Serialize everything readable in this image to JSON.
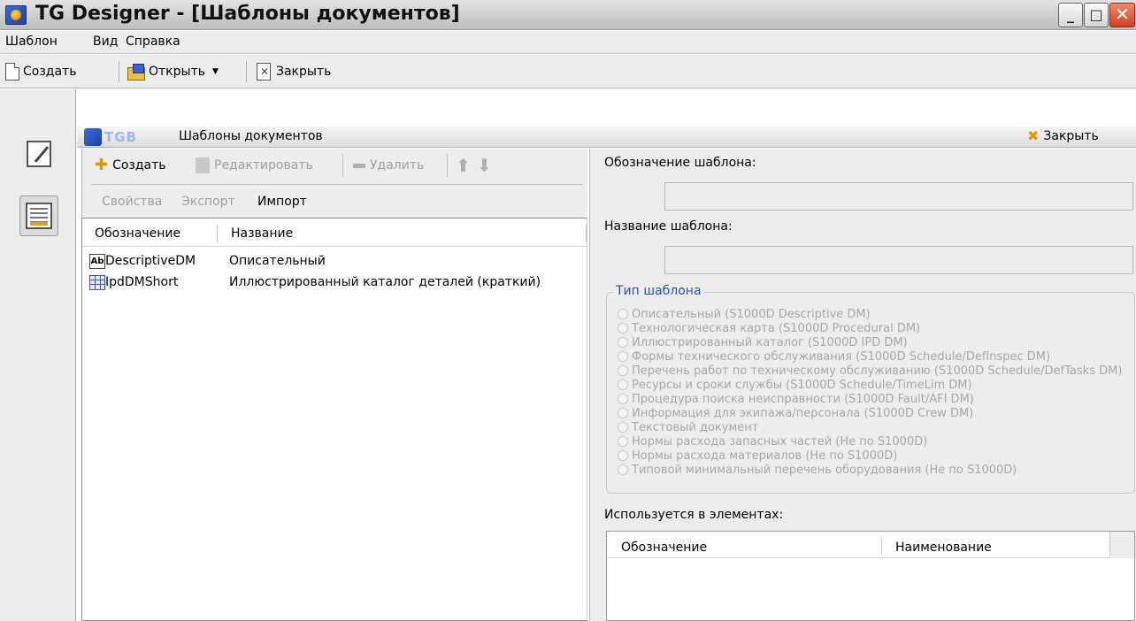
{
  "window": {
    "title": "TG Designer - [Шаблоны документов]",
    "minimize": "_",
    "maximize": "□",
    "close": "✕"
  },
  "menu": [
    "Шаблон",
    "Вид",
    "Справка"
  ],
  "toolbar": {
    "create": "Создать",
    "open": "Открыть",
    "open_arrow": "▼",
    "close": "Закрыть"
  },
  "panel": {
    "logo": "TGB",
    "title": "Шаблоны документов",
    "close": "Закрыть"
  },
  "list_toolbar": {
    "create": "Создать",
    "edit": "Редактировать",
    "delete": "Удалить",
    "properties": "Свойства",
    "export": "Экспорт",
    "import": "Импорт"
  },
  "list": {
    "columns": [
      "Обозначение",
      "Название"
    ],
    "rows": [
      {
        "icon": "Ab",
        "code": "DescriptiveDM",
        "name": "Описательный"
      },
      {
        "icon": "grid",
        "code": "IpdDMShort",
        "name": "Иллюстрированный каталог деталей (краткий)"
      }
    ]
  },
  "form": {
    "designation_label": "Обозначение шаблона:",
    "designation_value": "",
    "name_label": "Название шаблона:",
    "name_value": "",
    "type_legend": "Тип шаблона",
    "types": [
      "Описательный (S1000D Descriptive DM)",
      "Технологическая карта (S1000D Procedural DM)",
      "Иллюстрированный каталог (S1000D IPD DM)",
      "Формы технического обслуживания (S1000D Schedule/DefInspec DM)",
      "Перечень работ по техническому обслуживанию (S1000D Schedule/DefTasks DM)",
      "Ресурсы и сроки службы (S1000D Schedule/TimeLim DM)",
      "Процедура поиска неисправности (S1000D Fault/AFI DM)",
      "Информация для экипажа/персонала (S1000D Crew DM)",
      "Текстовый документ",
      "Нормы расхода запасных частей (Не по S1000D)",
      "Нормы расхода материалов (Не по S1000D)",
      "Типовой минимальный перечень оборудования (Не по S1000D)"
    ],
    "used_label": "Используется в элементах:",
    "used_columns": [
      "Обозначение",
      "Наименование"
    ]
  }
}
